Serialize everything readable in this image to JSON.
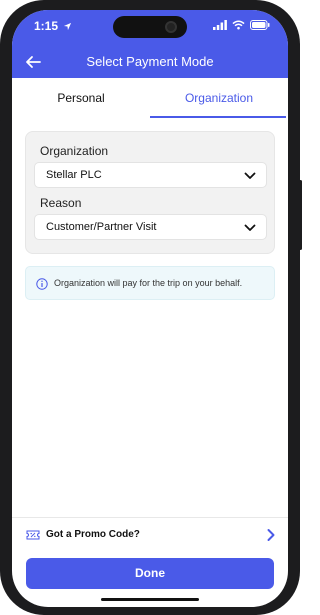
{
  "status_bar": {
    "time": "1:15"
  },
  "header": {
    "title": "Select Payment Mode"
  },
  "tabs": [
    {
      "label": "Personal",
      "active": false
    },
    {
      "label": "Organization",
      "active": true
    }
  ],
  "form": {
    "organization": {
      "label": "Organization",
      "value": "Stellar PLC"
    },
    "reason": {
      "label": "Reason",
      "value": "Customer/Partner Visit"
    }
  },
  "info": {
    "text": "Organization will pay for the trip on your behalf."
  },
  "promo": {
    "label": "Got a Promo Code?"
  },
  "done_button": {
    "label": "Done"
  },
  "colors": {
    "accent": "#4a5ae8",
    "info_bg": "#eef8fb",
    "card_bg": "#f2f2f2"
  }
}
